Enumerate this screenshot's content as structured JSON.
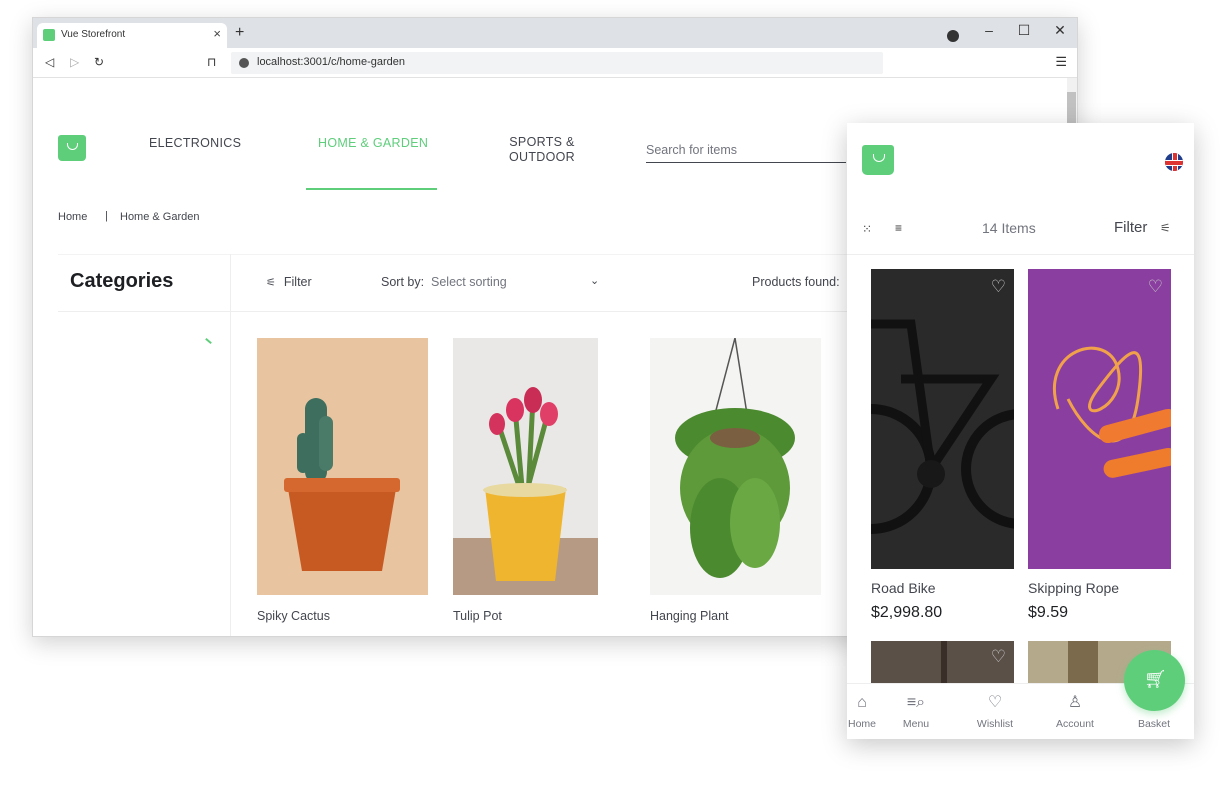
{
  "browser": {
    "tab_title": "Vue Storefront",
    "tab_close": "×",
    "new_tab": "+",
    "url": "localhost:3001/c/home-garden",
    "window_minimize": "–",
    "window_maximize": "☐",
    "window_close": "✕"
  },
  "header": {
    "nav": [
      {
        "label": "ELECTRONICS"
      },
      {
        "label": "HOME & GARDEN",
        "active": true
      },
      {
        "label_line1": "SPORTS &",
        "label_line2": "OUTDOOR"
      }
    ],
    "search_placeholder": "Search for items"
  },
  "breadcrumb": {
    "home": "Home",
    "separator": "|",
    "current": "Home & Garden"
  },
  "toolbar": {
    "categories_title": "Categories",
    "filter_label": "Filter",
    "sort_label": "Sort by:",
    "sort_value": "Select sorting",
    "products_found_label": "Products found:"
  },
  "products": [
    {
      "name": "Spiky Cactus"
    },
    {
      "name": "Tulip Pot"
    },
    {
      "name": "Hanging Plant"
    }
  ],
  "mobile": {
    "items_count": "14 Items",
    "filter_label": "Filter",
    "products": [
      {
        "name": "Road Bike",
        "price": "$2,998.80"
      },
      {
        "name": "Skipping Rope",
        "price": "$9.59"
      }
    ],
    "bottom_nav": [
      {
        "label": "Home",
        "icon": "home-icon"
      },
      {
        "label": "Menu",
        "icon": "menu-search-icon"
      },
      {
        "label": "Wishlist",
        "icon": "heart-icon"
      },
      {
        "label": "Account",
        "icon": "user-icon"
      },
      {
        "label": "Basket",
        "icon": "cart-icon"
      }
    ]
  },
  "colors": {
    "accent": "#5ece7b",
    "text": "#1d1f22",
    "muted": "#72757e",
    "rope_bg": "#8a3fa0",
    "bike_bg": "#2a2a2a"
  }
}
